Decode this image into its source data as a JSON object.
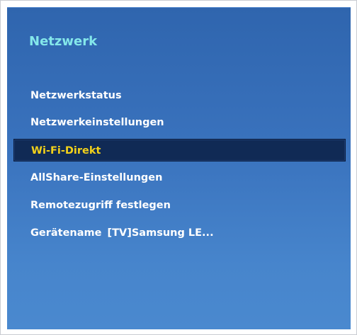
{
  "menu": {
    "title": "Netzwerk",
    "items": [
      {
        "label": "Netzwerkstatus",
        "value": "",
        "selected": false
      },
      {
        "label": "Netzwerkeinstellungen",
        "value": "",
        "selected": false
      },
      {
        "label": "Wi-Fi-Direkt",
        "value": "",
        "selected": true
      },
      {
        "label": "AllShare-Einstellungen",
        "value": "",
        "selected": false
      },
      {
        "label": "Remotezugriff festlegen",
        "value": "",
        "selected": false
      },
      {
        "label": "Gerätename",
        "value": "[TV]Samsung LE...",
        "selected": false
      }
    ]
  },
  "colors": {
    "panel_top": "#2f65ae",
    "panel_bottom": "#4a89cf",
    "title": "#84e7ea",
    "item_text": "#ffffff",
    "selected_bg": "#102a55",
    "selected_text": "#f2d11a"
  }
}
